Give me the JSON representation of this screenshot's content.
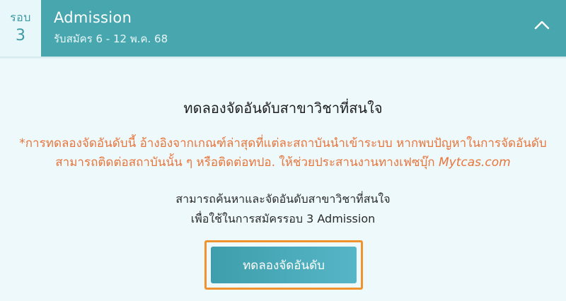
{
  "header": {
    "round_label": "รอบ",
    "round_number": "3",
    "title": "Admission",
    "subtitle": "รับสมัคร 6 - 12 พ.ค. 68",
    "toggle_icon": "chevron-up-icon"
  },
  "main": {
    "title": "ทดลองจัดอันดับสาขาวิชาที่สนใจ",
    "notice_line1": "*การทดลองจัดอันดับนี้ อ้างอิงจากเกณฑ์ล่าสุดที่แต่ละสถาบันนำเข้าระบบ หากพบปัญหาในการจัดอันดับ",
    "notice_line2": "สามารถติดต่อสถาบันนั้น ๆ หรือติดต่อทปอ. ให้ช่วยประสานงานทางเฟซบุ๊ก",
    "notice_brand": "Mytcas.com",
    "desc_line1": "สามารถค้นหาและจัดอันดับสาขาวิชาที่สนใจ",
    "desc_line2": "เพื่อใช้ในการสมัครรอบ 3 Admission",
    "cta_label": "ทดลองจัดอันดับ"
  },
  "colors": {
    "header_bg": "#48a6ae",
    "round_box_bg": "#e8f8fa",
    "page_bg": "#eef9fb",
    "notice_text": "#e8753c",
    "cta_frame": "#f0922e",
    "cta_bg": "#4aabb9"
  }
}
